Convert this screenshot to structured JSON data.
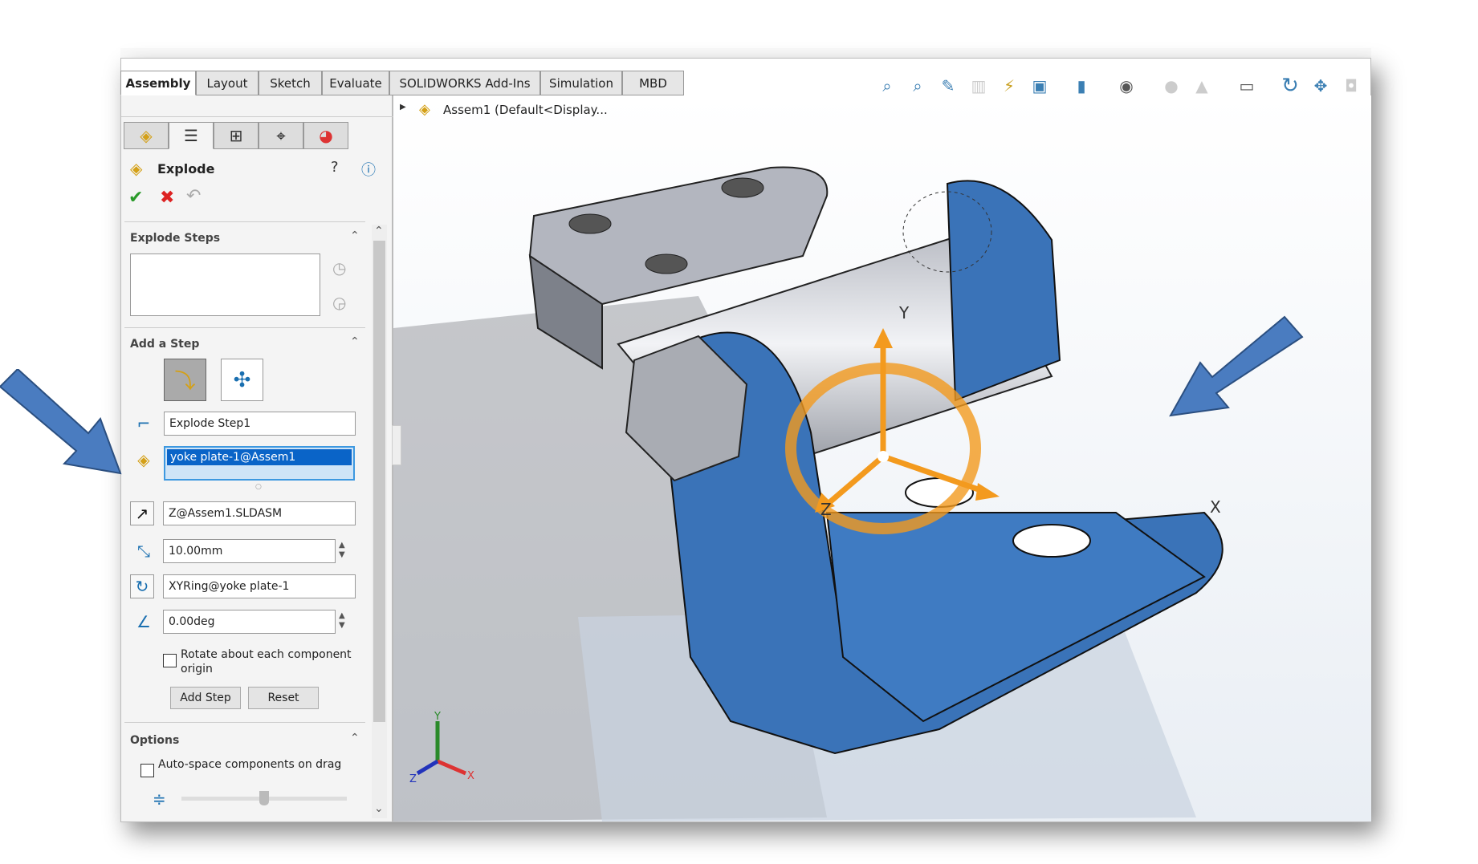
{
  "ribbon": {
    "tabs": [
      "Assembly",
      "Layout",
      "Sketch",
      "Evaluate",
      "SOLIDWORKS Add-Ins",
      "Simulation",
      "MBD"
    ],
    "active": "Assembly"
  },
  "panel": {
    "title": "Explode",
    "explode_steps": {
      "header": "Explode Steps"
    },
    "add_step": {
      "header": "Add a Step",
      "step_name": "Explode Step1",
      "component": "yoke plate-1@Assem1",
      "direction": "Z@Assem1.SLDASM",
      "distance": "10.00mm",
      "rotation_axis": "XYRing@yoke plate-1",
      "angle": "0.00deg",
      "rotate_origin_label": "Rotate about each component origin",
      "rotate_origin_checked": false,
      "add_step_button": "Add Step",
      "reset_button": "Reset"
    },
    "options": {
      "header": "Options",
      "auto_space_label": "Auto-space components on drag",
      "auto_space_checked": false,
      "spacing_slider": 0.5
    }
  },
  "viewport": {
    "tree_root": "Assem1  (Default<Display...",
    "triad_labels": {
      "x": "X",
      "y": "Y",
      "z": "Z"
    },
    "model_color": "#3a73b8",
    "triad_color": "#f39a1e",
    "callout_arrow_color": "#4a7cc0"
  },
  "toolbar_icons": [
    "zoom-to-fit",
    "zoom-to-area",
    "previous-view",
    "section-view",
    "dynamic-annotation",
    "view-orientation",
    "display-style",
    "hide-show",
    "edit-appearance",
    "apply-scene",
    "view-settings",
    "rotate",
    "pan",
    "screen-capture"
  ]
}
